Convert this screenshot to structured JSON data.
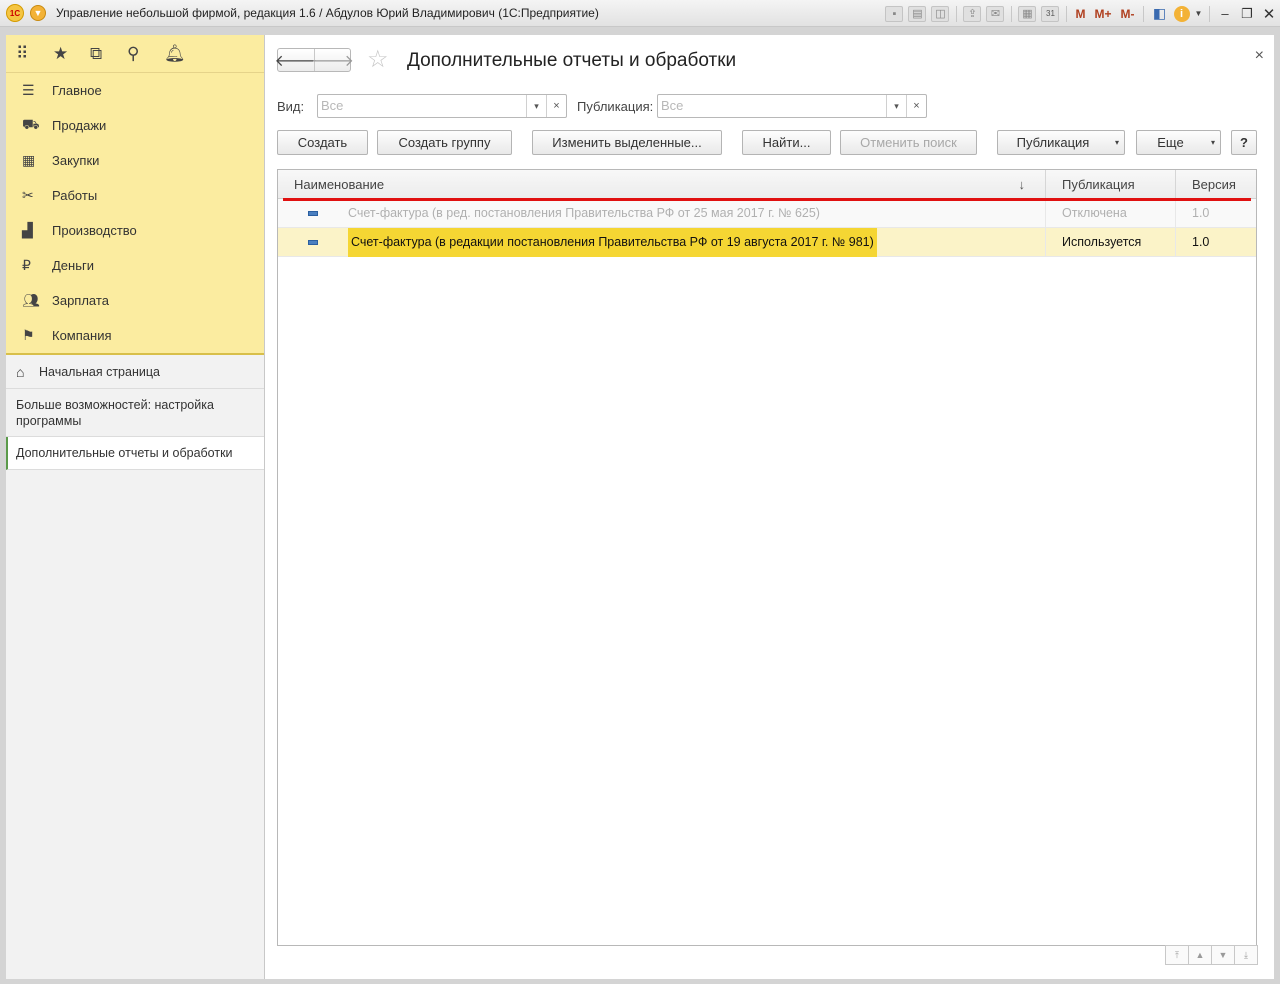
{
  "window": {
    "title": "Управление небольшой фирмой, редакция 1.6 / Абдулов Юрий Владимирович  (1С:Предприятие)",
    "logo_text": "1С",
    "toolbar_m": "M",
    "toolbar_mplus": "M+",
    "toolbar_mminus": "M-",
    "toolbar_calendar_day": "31"
  },
  "sidebar": {
    "sections": [
      {
        "label": "Главное",
        "icon": "menu-icon"
      },
      {
        "label": "Продажи",
        "icon": "basket-icon"
      },
      {
        "label": "Закупки",
        "icon": "purchases-icon"
      },
      {
        "label": "Работы",
        "icon": "tools-icon"
      },
      {
        "label": "Производство",
        "icon": "factory-icon"
      },
      {
        "label": "Деньги",
        "icon": "ruble-icon"
      },
      {
        "label": "Зарплата",
        "icon": "people-icon"
      },
      {
        "label": "Компания",
        "icon": "flag-icon"
      }
    ],
    "home": "Начальная страница",
    "more": "Больше возможностей: настройка программы",
    "active": "Дополнительные отчеты и обработки"
  },
  "main": {
    "title": "Дополнительные отчеты и обработки",
    "filters": {
      "kind_label": "Вид:",
      "kind_placeholder": "Все",
      "publication_label": "Публикация:",
      "publication_placeholder": "Все"
    },
    "buttons": {
      "create": "Создать",
      "create_group": "Создать группу",
      "edit_selected": "Изменить выделенные...",
      "find": "Найти...",
      "cancel_search": "Отменить поиск",
      "publication": "Публикация",
      "more": "Еще",
      "help": "?"
    },
    "table": {
      "columns": [
        "Наименование",
        "Публикация",
        "Версия"
      ],
      "rows": [
        {
          "name": "Счет-фактура (в ред. постановления Правительства РФ от 25 мая 2017 г. № 625)",
          "publication": "Отключена",
          "version": "1.0"
        },
        {
          "name": "Счет-фактура (в редакции постановления Правительства РФ от 19 августа 2017 г. № 981)",
          "publication": "Используется",
          "version": "1.0"
        }
      ]
    }
  },
  "colors": {
    "sidebar_bg": "#fbeca0",
    "selected_highlight": "#f5d633",
    "annotation_line": "#e01010"
  }
}
